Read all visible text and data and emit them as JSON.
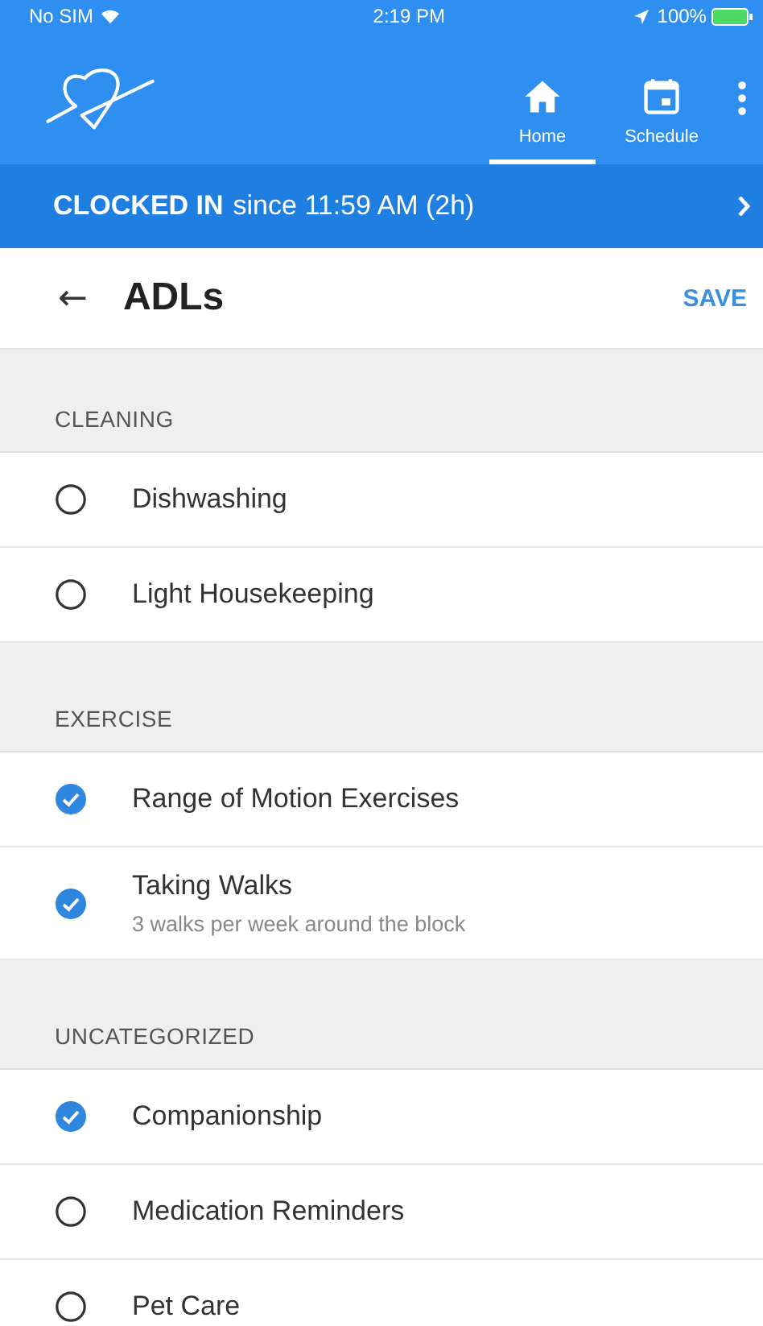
{
  "status_bar": {
    "carrier": "No SIM",
    "time": "2:19 PM",
    "battery": "100%"
  },
  "tabs": [
    {
      "label": "Home",
      "kind": "home",
      "selected": true
    },
    {
      "label": "Schedule",
      "kind": "calendar",
      "selected": false
    }
  ],
  "clock_banner": {
    "status": "CLOCKED IN",
    "since": "since 11:59 AM (2h)"
  },
  "header": {
    "back": "←",
    "title": "ADLs",
    "action": "SAVE"
  },
  "sections": [
    {
      "title": "CLEANING",
      "items": [
        {
          "label": "Dishwashing",
          "checked": false
        },
        {
          "label": "Light Housekeeping",
          "checked": false
        }
      ]
    },
    {
      "title": "EXERCISE",
      "items": [
        {
          "label": "Range of Motion Exercises",
          "checked": true
        },
        {
          "label": "Taking Walks",
          "note": "3 walks per week around the block",
          "checked": true
        }
      ]
    },
    {
      "title": "UNCATEGORIZED",
      "items": [
        {
          "label": "Companionship",
          "checked": true
        },
        {
          "label": "Medication Reminders",
          "checked": false
        },
        {
          "label": "Pet Care",
          "checked": false
        }
      ]
    }
  ]
}
